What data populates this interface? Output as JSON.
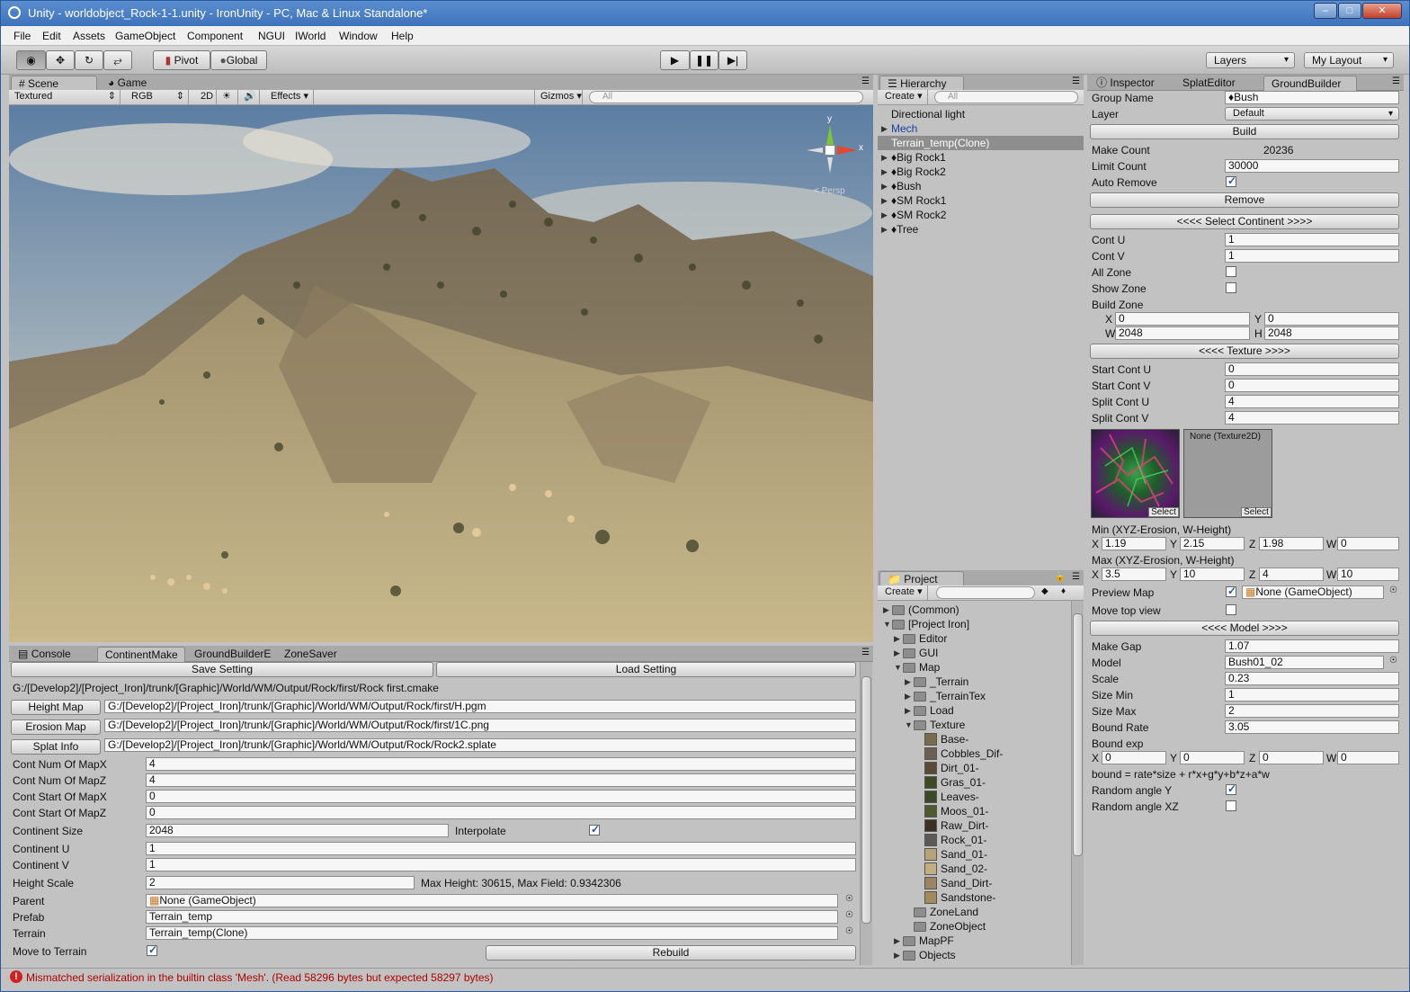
{
  "window": {
    "title": "Unity - worldobject_Rock-1-1.unity - IronUnity - PC, Mac & Linux Standalone*"
  },
  "menu": [
    "File",
    "Edit",
    "Assets",
    "GameObject",
    "Component",
    "NGUI",
    "IWorld",
    "Window",
    "Help"
  ],
  "toolbar": {
    "pivot": "Pivot",
    "global": "Global",
    "layers": "Layers",
    "layout": "My Layout"
  },
  "scene": {
    "tabs": [
      "Scene",
      "Game"
    ],
    "render_mode": "Textured",
    "color_mode": "RGB",
    "mode_2d": "2D",
    "effects": "Effects",
    "gizmos": "Gizmos",
    "search_placeholder": "All",
    "persp_label": "Persp",
    "gizmo_y": "y",
    "gizmo_x": "x"
  },
  "hierarchy": {
    "tab": "Hierarchy",
    "create": "Create",
    "search_placeholder": "All",
    "items": [
      {
        "label": "Directional light",
        "arrow": false
      },
      {
        "label": "Mech",
        "arrow": true
      },
      {
        "label": "Terrain_temp(Clone)",
        "arrow": false
      },
      {
        "label": "♦Big Rock1",
        "arrow": true
      },
      {
        "label": "♦Big Rock2",
        "arrow": true
      },
      {
        "label": "♦Bush",
        "arrow": true
      },
      {
        "label": "♦SM Rock1",
        "arrow": true
      },
      {
        "label": "♦SM Rock2",
        "arrow": true
      },
      {
        "label": "♦Tree",
        "arrow": true
      }
    ]
  },
  "project": {
    "tab": "Project",
    "create": "Create",
    "items": [
      {
        "label": "(Common)",
        "indent": 0,
        "arrow": "▶",
        "type": "folder"
      },
      {
        "label": "[Project Iron]",
        "indent": 0,
        "arrow": "▼",
        "type": "folder"
      },
      {
        "label": "Editor",
        "indent": 1,
        "arrow": "▶",
        "type": "folder"
      },
      {
        "label": "GUI",
        "indent": 1,
        "arrow": "▶",
        "type": "folder"
      },
      {
        "label": "Map",
        "indent": 1,
        "arrow": "▼",
        "type": "folder"
      },
      {
        "label": "_Terrain",
        "indent": 2,
        "arrow": "▶",
        "type": "folder"
      },
      {
        "label": "_TerrainTex",
        "indent": 2,
        "arrow": "▶",
        "type": "folder"
      },
      {
        "label": "Load",
        "indent": 2,
        "arrow": "▶",
        "type": "folder"
      },
      {
        "label": "Texture",
        "indent": 2,
        "arrow": "▼",
        "type": "folder"
      },
      {
        "label": "Base-",
        "indent": 3,
        "arrow": "",
        "type": "tex",
        "color": "#7a6a4e"
      },
      {
        "label": "Cobbles_Dif-",
        "indent": 3,
        "arrow": "",
        "type": "tex",
        "color": "#6b5f52"
      },
      {
        "label": "Dirt_01-",
        "indent": 3,
        "arrow": "",
        "type": "tex",
        "color": "#5a4a36"
      },
      {
        "label": "Gras_01-",
        "indent": 3,
        "arrow": "",
        "type": "tex",
        "color": "#3d4a22"
      },
      {
        "label": "Leaves-",
        "indent": 3,
        "arrow": "",
        "type": "tex",
        "color": "#3a4a28"
      },
      {
        "label": "Moos_01-",
        "indent": 3,
        "arrow": "",
        "type": "tex",
        "color": "#4e5a2e"
      },
      {
        "label": "Raw_Dirt-",
        "indent": 3,
        "arrow": "",
        "type": "tex",
        "color": "#3a3026"
      },
      {
        "label": "Rock_01-",
        "indent": 3,
        "arrow": "",
        "type": "tex",
        "color": "#5c5a56"
      },
      {
        "label": "Sand_01-",
        "indent": 3,
        "arrow": "",
        "type": "tex",
        "color": "#b7a378"
      },
      {
        "label": "Sand_02-",
        "indent": 3,
        "arrow": "",
        "type": "tex",
        "color": "#c3ae82"
      },
      {
        "label": "Sand_Dirt-",
        "indent": 3,
        "arrow": "",
        "type": "tex",
        "color": "#9a8462"
      },
      {
        "label": "Sandstone-",
        "indent": 3,
        "arrow": "",
        "type": "tex",
        "color": "#a38a5e"
      },
      {
        "label": "ZoneLand",
        "indent": 2,
        "arrow": "",
        "type": "folder"
      },
      {
        "label": "ZoneObject",
        "indent": 2,
        "arrow": "",
        "type": "folder"
      },
      {
        "label": "MapPF",
        "indent": 1,
        "arrow": "▶",
        "type": "folder"
      },
      {
        "label": "Objects",
        "indent": 1,
        "arrow": "▶",
        "type": "folder"
      }
    ]
  },
  "inspector": {
    "tabs": [
      "Inspector",
      "SplatEditor",
      "GroundBuilder"
    ],
    "group_name_label": "Group Name",
    "group_name": "♦Bush",
    "layer_label": "Layer",
    "layer": "Default",
    "build": "Build",
    "make_count_label": "Make Count",
    "make_count": "20236",
    "limit_count_label": "Limit Count",
    "limit_count": "30000",
    "auto_remove_label": "Auto Remove",
    "remove": "Remove",
    "select_continent": "<<<< Select Continent >>>>",
    "cont_u_label": "Cont U",
    "cont_u": "1",
    "cont_v_label": "Cont V",
    "cont_v": "1",
    "all_zone_label": "All Zone",
    "show_zone_label": "Show Zone",
    "build_zone_label": "Build Zone",
    "bz_x": "0",
    "bz_y": "0",
    "bz_w": "2048",
    "bz_h": "2048",
    "texture_header": "<<<< Texture >>>>",
    "start_cont_u_label": "Start Cont U",
    "start_cont_u": "0",
    "start_cont_v_label": "Start Cont V",
    "start_cont_v": "0",
    "split_cont_u_label": "Split Cont U",
    "split_cont_u": "4",
    "split_cont_v_label": "Split Cont V",
    "split_cont_v": "4",
    "select": "Select",
    "none_texture": "None (Texture2D)",
    "min_label": "Min (XYZ-Erosion, W-Height)",
    "min_x": "1.19",
    "min_y": "2.15",
    "min_z": "1.98",
    "min_w": "0",
    "max_label": "Max (XYZ-Erosion, W-Height)",
    "max_x": "3.5",
    "max_y": "10",
    "max_z": "4",
    "max_w": "10",
    "preview_map_label": "Preview Map",
    "preview_map": "None (GameObject)",
    "move_top_view_label": "Move top view",
    "model_header": "<<<< Model >>>>",
    "make_gap_label": "Make Gap",
    "make_gap": "1.07",
    "model_label": "Model",
    "model": "Bush01_02",
    "scale_label": "Scale",
    "scale": "0.23",
    "size_min_label": "Size Min",
    "size_min": "1",
    "size_max_label": "Size Max",
    "size_max": "2",
    "bound_rate_label": "Bound Rate",
    "bound_rate": "3.05",
    "bound_exp_label": "Bound exp",
    "be_x": "0",
    "be_y": "0",
    "be_z": "0",
    "be_w": "0",
    "formula": "bound = rate*size + r*x+g*y+b*z+a*w",
    "random_y_label": "Random angle Y",
    "random_xz_label": "Random angle XZ",
    "axis": {
      "x": "X",
      "y": "Y",
      "z": "Z",
      "w": "W",
      "h": "H"
    }
  },
  "continent": {
    "tabs": [
      "Console",
      "ContinentMake",
      "GroundBuilderE",
      "ZoneSaver"
    ],
    "save_setting": "Save Setting",
    "load_setting": "Load Setting",
    "path": "G:/[Develop2]/[Project_Iron]/trunk/[Graphic]/World/WM/Output/Rock/first/Rock first.cmake",
    "height_map": "Height Map",
    "height_map_path": "G:/[Develop2]/[Project_Iron]/trunk/[Graphic]/World/WM/Output/Rock/first/H.pgm",
    "erosion_map": "Erosion Map",
    "erosion_map_path": "G:/[Develop2]/[Project_Iron]/trunk/[Graphic]/World/WM/Output/Rock/first/1C.png",
    "splat_info": "Splat Info",
    "splat_info_path": "G:/[Develop2]/[Project_Iron]/trunk/[Graphic]/World/WM/Output/Rock/Rock2.splate",
    "cont_num_x_label": "Cont Num Of MapX",
    "cont_num_x": "4",
    "cont_num_z_label": "Cont Num Of MapZ",
    "cont_num_z": "4",
    "cont_start_x_label": "Cont Start Of MapX",
    "cont_start_x": "0",
    "cont_start_z_label": "Cont Start Of MapZ",
    "cont_start_z": "0",
    "continent_size_label": "Continent Size",
    "continent_size": "2048",
    "interpolate_label": "Interpolate",
    "continent_u_label": "Continent U",
    "continent_u": "1",
    "continent_v_label": "Continent V",
    "continent_v": "1",
    "height_scale_label": "Height Scale",
    "height_scale": "2",
    "max_info": "Max Height: 30615, Max Field: 0.9342306",
    "parent_label": "Parent",
    "parent": "None (GameObject)",
    "prefab_label": "Prefab",
    "prefab": "Terrain_temp",
    "terrain_label": "Terrain",
    "terrain": "Terrain_temp(Clone)",
    "move_to_terrain_label": "Move to Terrain",
    "rebuild": "Rebuild"
  },
  "status": {
    "message": "Mismatched serialization in the builtin class 'Mesh'. (Read 58296 bytes but expected 58297 bytes)",
    "color": "#b00000"
  },
  "colors": {
    "accent": "#3d72bb",
    "selection": "#8e8e8e"
  }
}
